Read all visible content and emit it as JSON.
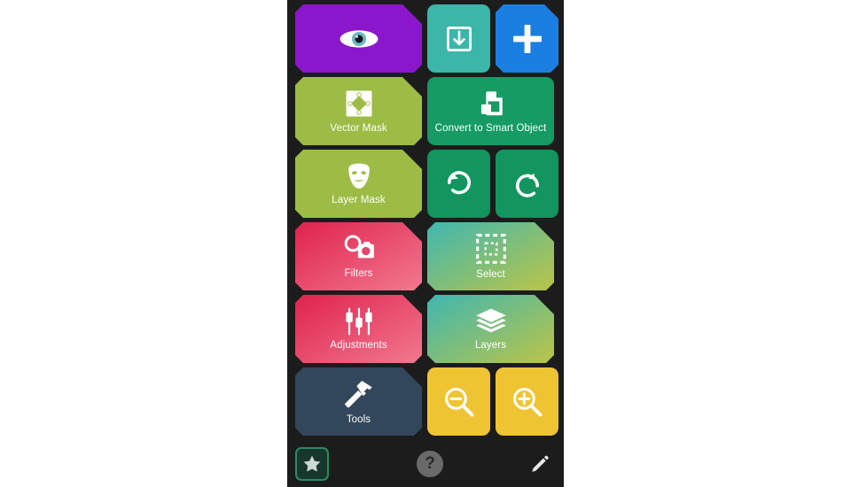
{
  "app": {
    "background_color": "#1c1c1c",
    "canvas_color": "#ffffff"
  },
  "grid": {
    "rows": [
      {
        "tiles": [
          {
            "id": "preview",
            "label": "",
            "icon": "eye-icon",
            "size": "wide",
            "shape": "chamfer",
            "color": "#8a17cb",
            "color2": "#8a17cb"
          },
          {
            "id": "import",
            "label": "",
            "icon": "download-box-icon",
            "size": "small",
            "shape": "rounded",
            "color": "#3cb6a9",
            "color2": "#3cb6a9"
          },
          {
            "id": "add",
            "label": "",
            "icon": "plus-icon",
            "size": "small",
            "shape": "chamfer-sm",
            "color": "#1a7fe0",
            "color2": "#1a7fe0"
          }
        ]
      },
      {
        "tiles": [
          {
            "id": "vector-mask",
            "label": "Vector Mask",
            "icon": "vector-mask-icon",
            "size": "wide",
            "shape": "chamfer",
            "color": "#9cbc46",
            "color2": "#9cbc46"
          },
          {
            "id": "convert-smart",
            "label": "Convert to Smart Object",
            "icon": "smart-object-icon",
            "size": "wide",
            "shape": "rounded",
            "color": "#159b63",
            "color2": "#159b63"
          }
        ]
      },
      {
        "tiles": [
          {
            "id": "layer-mask",
            "label": "Layer Mask",
            "icon": "theater-mask-icon",
            "size": "wide",
            "shape": "chamfer",
            "color": "#9cbc46",
            "color2": "#9cbc46"
          },
          {
            "id": "undo",
            "label": "",
            "icon": "undo-icon",
            "size": "small",
            "shape": "rounded",
            "color": "#12955e",
            "color2": "#12955e"
          },
          {
            "id": "redo",
            "label": "",
            "icon": "redo-icon",
            "size": "small",
            "shape": "rounded",
            "color": "#12955e",
            "color2": "#12955e"
          }
        ]
      },
      {
        "tiles": [
          {
            "id": "filters",
            "label": "Filters",
            "icon": "camera-filters-icon",
            "size": "wide",
            "shape": "chamfer",
            "color": "#e0224f",
            "color2": "#f1798f"
          },
          {
            "id": "select",
            "label": "Select",
            "icon": "marquee-select-icon",
            "size": "wide",
            "shape": "chamfer",
            "color": "#3fb7b0",
            "color2": "#bcc447"
          }
        ]
      },
      {
        "tiles": [
          {
            "id": "adjustments",
            "label": "Adjustments",
            "icon": "sliders-icon",
            "size": "wide",
            "shape": "chamfer",
            "color": "#e0224f",
            "color2": "#f1798f"
          },
          {
            "id": "layers",
            "label": "Layers",
            "icon": "layers-icon",
            "size": "wide",
            "shape": "chamfer",
            "color": "#3fb7b0",
            "color2": "#bcc447"
          }
        ]
      },
      {
        "tiles": [
          {
            "id": "tools",
            "label": "Tools",
            "icon": "hammer-icon",
            "size": "wide",
            "shape": "chamfer",
            "color": "#33475c",
            "color2": "#33475c"
          },
          {
            "id": "zoom-out",
            "label": "",
            "icon": "zoom-out-icon",
            "size": "small",
            "shape": "rounded",
            "color": "#efc433",
            "color2": "#efc433"
          },
          {
            "id": "zoom-in",
            "label": "",
            "icon": "zoom-in-icon",
            "size": "small",
            "shape": "rounded",
            "color": "#efc433",
            "color2": "#efc433"
          }
        ]
      }
    ]
  },
  "bottom_bar": {
    "star_button": {
      "icon": "star-icon",
      "fill": "#17372c",
      "border": "#2e8a63"
    },
    "help_button": {
      "icon": "question-mark-icon",
      "label": "?"
    },
    "pencil_button": {
      "icon": "pencil-icon"
    }
  }
}
